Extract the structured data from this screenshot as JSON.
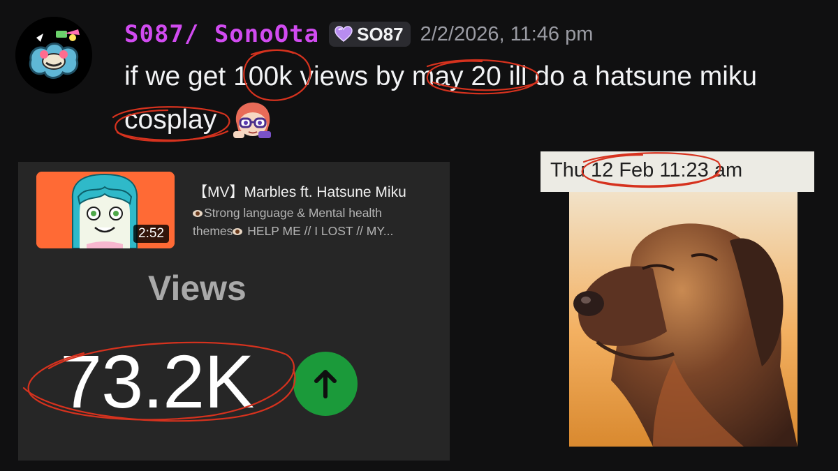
{
  "message": {
    "username": "S087/ SonoOta",
    "role_tag": "SO87",
    "timestamp": "2/2/2026, 11:46 pm",
    "line1": "if we get 100k views by may 20 ill do a hatsune miku",
    "line2": "cosplay",
    "username_color": "#d14bf0"
  },
  "video": {
    "title": "【MV】Marbles ft. Hatsune Miku",
    "description_line1": "Strong language & Mental health",
    "description_line2_a": "themes",
    "description_line2_b": " HELP ME // I LOST // MY...",
    "duration": "2:52",
    "views_label": "Views",
    "views_count": "73.2K",
    "thumbnail_bg": "#ff6a35"
  },
  "meme": {
    "date_text": "Thu 12 Feb  11:23 am"
  },
  "icons": {
    "avatar": "clown-avatar-icon",
    "role": "purple-heart-icon",
    "emoji": "nerd-glasses-emoji",
    "trend": "arrow-up-icon"
  },
  "colors": {
    "annotation": "#d6321e",
    "trend_green": "#1b9a3a"
  }
}
